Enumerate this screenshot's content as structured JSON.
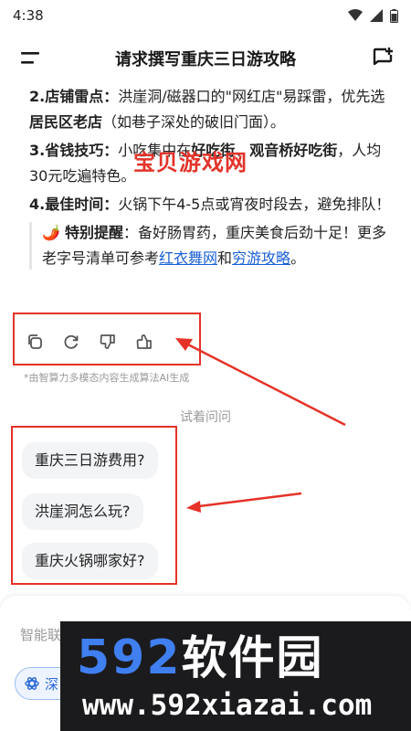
{
  "status_bar": {
    "time": "4:38"
  },
  "header": {
    "title": "请求撰写重庆三日游攻略"
  },
  "content": {
    "item2": {
      "label": "2.店铺雷点：",
      "text1": "洪崖洞/磁器口的\"网红店\"易踩雷，优先选 ",
      "bold": "居民区老店",
      "text2": "（如巷子深处的破旧门面）。"
    },
    "item3": {
      "label": "3.省钱技巧：",
      "text1": "小吃集中在",
      "bold_a": "好吃街",
      "text2": "、",
      "bold_b": "观音桥好吃街",
      "text3": "，人均30元吃遍特色。"
    },
    "item4": {
      "label": "4.最佳时间：",
      "text": "火锅下午4-5点或宵夜时段去，避免排队！"
    },
    "tip": {
      "emoji": "🌶️",
      "label": "特别提醒",
      "text": "：备好肠胃药，重庆美食后劲十足！更多老字号清单可参考",
      "link1": "红衣舞网",
      "mid": "和",
      "link2": "穷游攻略",
      "end": "。"
    }
  },
  "watermark_top": "宝贝游戏网",
  "actions": {
    "copy": "copy-icon",
    "regenerate": "refresh-icon",
    "dislike": "thumbs-down-icon",
    "like": "thumbs-up-icon"
  },
  "ai_note": "*由智算力多模态内容生成算法AI生成",
  "try_ask": "试着问问",
  "suggestions": [
    "重庆三日游费用?",
    "洪崖洞怎么玩?",
    "重庆火锅哪家好?"
  ],
  "input": {
    "placeholder": "智能联",
    "deep_label": "深"
  },
  "banner": {
    "logo_num": "592",
    "logo_cn": "软件园",
    "url": "www.592xiazai.com"
  },
  "colors": {
    "annotation_red": "#e53228",
    "link_blue": "#1a5fd6",
    "banner_bg": "#1b1a1d",
    "banner_blue": "#3f7ff0"
  }
}
